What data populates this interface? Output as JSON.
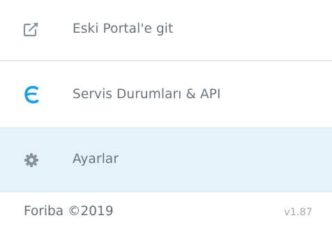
{
  "menu": {
    "items": [
      {
        "label": "Eski Portal'e git",
        "icon": "external-link-icon"
      },
      {
        "label": "Servis Durumları & API",
        "icon": "e-logo-icon"
      },
      {
        "label": "Ayarlar",
        "icon": "gear-icon",
        "active": true
      }
    ]
  },
  "footer": {
    "copyright": "Foriba ©2019",
    "version": "v1.87"
  },
  "colors": {
    "active_background": "#e5f2fa",
    "logo_blue": "#1a9fe0",
    "text": "#6b737a",
    "icon_gray": "#8a9197"
  }
}
